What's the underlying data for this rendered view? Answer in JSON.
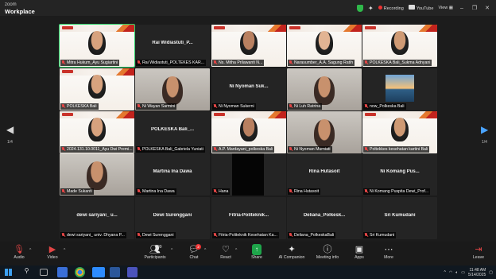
{
  "titlebar": {
    "brand_top": "zoom",
    "brand_bottom": "Workplace",
    "recording_label": "Recording",
    "youtube_label": "YouTube",
    "view_label": "View"
  },
  "gallery": {
    "page_left": "1/4",
    "page_right": "1/4",
    "tiles": [
      {
        "name": "Mitra Hukum_Ayu Sugiartini",
        "display": "",
        "kind": "slide",
        "active": true
      },
      {
        "name": "Rai Widiastuti_POLTEKES KAR...",
        "display": "Rai Widiastuti_P...",
        "kind": "dark"
      },
      {
        "name": "Ns. Mitha Prilawanti N...",
        "display": "",
        "kind": "slide"
      },
      {
        "name": "Narasumber_A.A. Sagung Ratih",
        "display": "",
        "kind": "slide"
      },
      {
        "name": "POLKESKA Bali_Sukma Adnyani",
        "display": "",
        "kind": "slide"
      },
      {
        "name": "POLKESKA Bali",
        "display": "",
        "kind": "slide"
      },
      {
        "name": "Ni Wayan Sarmini",
        "display": "",
        "kind": "room"
      },
      {
        "name": "Ni Nyoman Sukerni",
        "display": "Ni Nyoman Suk...",
        "kind": "dark"
      },
      {
        "name": "Ni Luh Ratrina",
        "display": "",
        "kind": "room"
      },
      {
        "name": "now_Polkeska Bali",
        "display": "",
        "kind": "sea"
      },
      {
        "name": "2024.131.10.0011_Ayu Dwi Premi...",
        "display": "",
        "kind": "slide"
      },
      {
        "name": "POLKESKA Bali_Gabriela Yuniati",
        "display": "POLKESKA Bali_...",
        "kind": "dark"
      },
      {
        "name": "A.P. Mardayani_polkeska Bali",
        "display": "",
        "kind": "slide"
      },
      {
        "name": "Ni Nyoman Murniati",
        "display": "",
        "kind": "room"
      },
      {
        "name": "Poltekkes kesehatan kartini Bali",
        "display": "",
        "kind": "slide"
      },
      {
        "name": "Made Sukanti",
        "display": "",
        "kind": "room"
      },
      {
        "name": "Martina Ina Dawa",
        "display": "Martina Ina Dawa",
        "kind": "dark"
      },
      {
        "name": "Hana",
        "display": "",
        "kind": "black"
      },
      {
        "name": "Rina Hutasoit",
        "display": "Rina Hutasoit",
        "kind": "dark"
      },
      {
        "name": "Ni Komang Puspita Dewi_Prof...",
        "display": "Ni Komang Pus...",
        "kind": "dark"
      },
      {
        "name": "dewi sariyani_ univ. Dhyana P...",
        "display": "dewi sariyani_ u...",
        "kind": "dark"
      },
      {
        "name": "Dewi Surenggani",
        "display": "Dewi Surenggani",
        "kind": "dark"
      },
      {
        "name": "Fitria-Politeknik Kesehatan Ka...",
        "display": "Fitria-Politeknik...",
        "kind": "dark"
      },
      {
        "name": "Deliana_PolkeskaBali",
        "display": "Deliana_Polkesk...",
        "kind": "dark"
      },
      {
        "name": "Sri Kumudani",
        "display": "Sri Kumudani",
        "kind": "dark"
      }
    ]
  },
  "toolbar": {
    "audio": "Audio",
    "video": "Video",
    "participants": "Participants",
    "participants_count": "99",
    "chat": "Chat",
    "chat_badge": "2",
    "react": "React",
    "share": "Share",
    "ai_companion": "AI Companion",
    "meeting_info": "Meeting info",
    "apps": "Apps",
    "more": "More",
    "leave": "Leave"
  },
  "taskbar": {
    "time": "11:48 AM",
    "date": "5/14/2025"
  },
  "colors": {
    "active_border": "#2fd36a",
    "mute_red": "#e24545",
    "share_green": "#1ea54a"
  }
}
